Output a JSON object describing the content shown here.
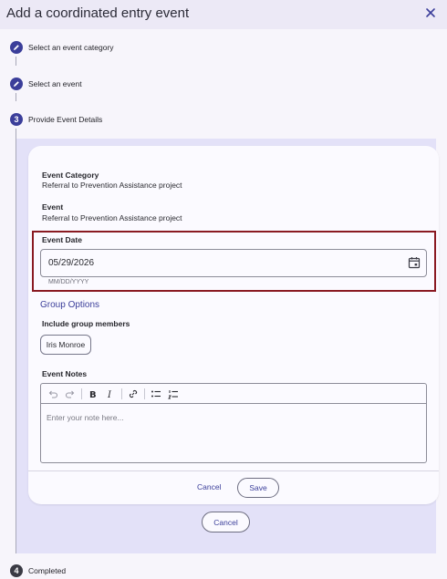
{
  "header": {
    "title": "Add a coordinated entry event",
    "close_icon": "close-icon"
  },
  "steps": [
    {
      "label": "Select an event category",
      "marker": "pencil-icon"
    },
    {
      "label": "Select an event",
      "marker": "pencil-icon"
    },
    {
      "label": "Provide Event Details",
      "number": "3"
    },
    {
      "label": "Completed",
      "number": "4"
    }
  ],
  "details": {
    "category_label": "Event Category",
    "category_value": "Referral to Prevention Assistance project",
    "event_label": "Event",
    "event_value": "Referral to Prevention Assistance project",
    "date_label": "Event Date",
    "date_value": "05/29/2026",
    "date_helper": "MM/DD/YYYY",
    "group_title": "Group Options",
    "include_label": "Include group members",
    "member_chip": "Iris Monroe",
    "notes_label": "Event Notes",
    "notes_placeholder": "Enter your note here..."
  },
  "card_actions": {
    "cancel": "Cancel",
    "save": "Save"
  },
  "outer_cancel": "Cancel",
  "colors": {
    "accent": "#3b3e9a",
    "highlight": "#8a1a22",
    "panel": "#e3e1f8"
  }
}
